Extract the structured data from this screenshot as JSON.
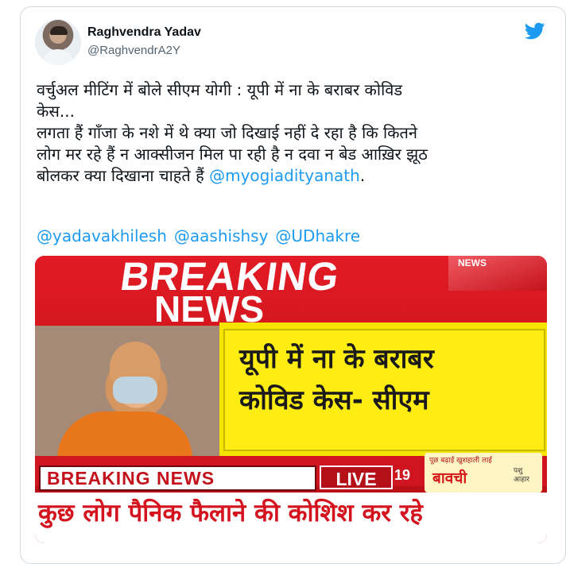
{
  "user": {
    "name": "Raghvendra Yadav",
    "handle": "@RaghvendrA2Y"
  },
  "icons": {
    "logo": "twitter-bird-icon",
    "brand_color": "#1d9bf0"
  },
  "tweet": {
    "line1": "वर्चुअल मीटिंग में बोले सीएम योगी : यूपी में ना के बराबर कोविड",
    "line2": "केस...",
    "line3": "लगता हैं गाँजा के नशे में थे क्या जो दिखाई नहीं दे रहा है कि कितने",
    "line4": "लोग मर रहे हैं न आक्सीजन मिल पा रही है न दवा न बेड आख़िर झूठ",
    "line5_prefix": "बोलकर क्या दिखाना चाहते हैं ",
    "line5_mention": "@myogiadityanath",
    "line5_suffix": ".",
    "mentions": [
      "@yadavakhilesh",
      "@aashishsy",
      "@UDhakre"
    ]
  },
  "media": {
    "breaking_big": "BREAKING",
    "news_big": "NEWS",
    "corner_logo": "NEWS",
    "headline": "यूपी में ना के बराबर\nकोविड केस- सीएम",
    "breaking_strip": "BREAKING NEWS",
    "live_label": "LIVE",
    "live_number": "19",
    "ad_small": "पूछ बढ़ाई खुशहाली लाई",
    "ad_brand": "बावची",
    "ad_side": "पशु\nआहार",
    "bottom_text": "कुछ लोग पैनिक फैलाने की कोशिश कर रहे"
  }
}
